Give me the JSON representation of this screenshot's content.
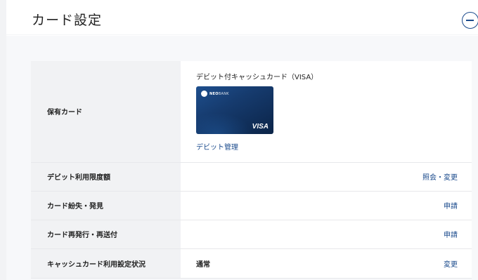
{
  "header": {
    "title": "カード設定"
  },
  "card": {
    "label": "保有カード",
    "name": "デビット付キャッシュカード（VISA）",
    "brand_logo_text_bold": "NEO",
    "brand_logo_text_thin": "BANK",
    "network": "VISA",
    "debit_link": "デビット管理"
  },
  "rows": [
    {
      "label": "デビット利用限度額",
      "value": "",
      "action": "照会・変更"
    },
    {
      "label": "カード紛失・発見",
      "value": "",
      "action": "申請"
    },
    {
      "label": "カード再発行・再送付",
      "value": "",
      "action": "申請"
    },
    {
      "label": "キャッシュカード利用設定状況",
      "value": "通常",
      "action": "変更"
    }
  ],
  "colors": {
    "accent": "#1a4a8c",
    "label_bg": "#f1f2f4",
    "background": "#f7f8fa"
  }
}
